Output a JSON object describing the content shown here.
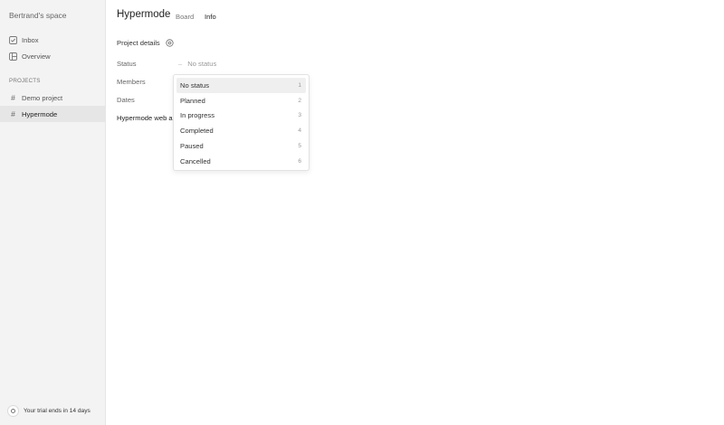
{
  "sidebar": {
    "workspace": "Bertrand's space",
    "nav": [
      {
        "label": "Inbox",
        "icon": "checkbox-icon"
      },
      {
        "label": "Overview",
        "icon": "board-icon"
      }
    ],
    "section_label": "PROJECTS",
    "projects": [
      {
        "label": "Demo project",
        "icon": "#"
      },
      {
        "label": "Hypermode",
        "icon": "#",
        "active": true
      }
    ],
    "trial_text": "Your trial ends in 14 days"
  },
  "header": {
    "title": "Hypermode",
    "tabs": [
      {
        "label": "Board",
        "active": false
      },
      {
        "label": "Info",
        "active": true
      }
    ]
  },
  "details": {
    "heading": "Project details",
    "status_label": "Status",
    "status_value": "No status",
    "members_label": "Members",
    "dates_label": "Dates",
    "project_name": "Hypermode web app"
  },
  "status_dropdown": {
    "options": [
      {
        "label": "No status",
        "key": "1",
        "highlighted": true
      },
      {
        "label": "Planned",
        "key": "2"
      },
      {
        "label": "In progress",
        "key": "3"
      },
      {
        "label": "Completed",
        "key": "4"
      },
      {
        "label": "Paused",
        "key": "5"
      },
      {
        "label": "Cancelled",
        "key": "6"
      }
    ]
  },
  "colors": {
    "sidebar_bg": "#f3f3f3",
    "active_item_bg": "#e6e6e6",
    "highlight_bg": "#efefef"
  }
}
